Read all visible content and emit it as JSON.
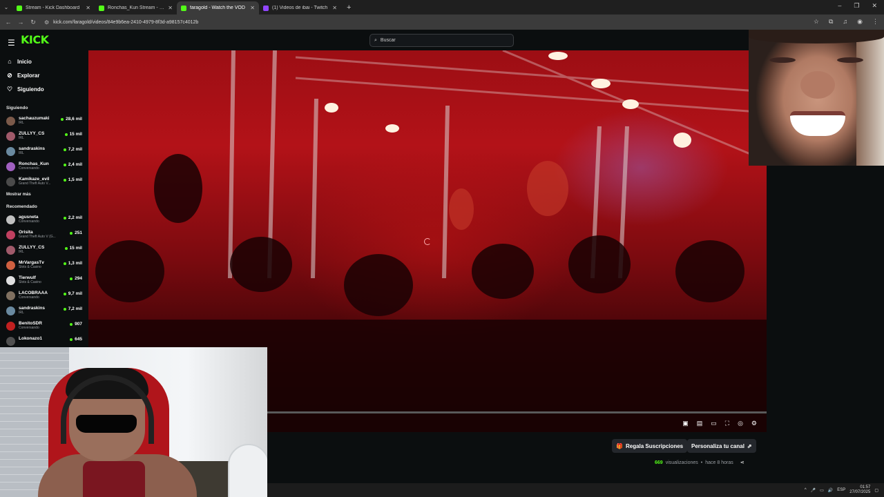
{
  "browser": {
    "tabs": [
      {
        "title": "Stream - Kick Dashboard",
        "color": "#53fc18",
        "active": false
      },
      {
        "title": "Ronchas_Kun Stream - Watch Liv",
        "color": "#53fc18",
        "active": false
      },
      {
        "title": "faragold - Watch the VOD",
        "color": "#53fc18",
        "active": true
      },
      {
        "title": "(1) Videos de ibai - Twitch",
        "color": "#9146ff",
        "active": false
      }
    ],
    "url": "kick.com/faragold/videos/84e9b6ea-2410-4979-8f3d-a98157c4012b"
  },
  "header": {
    "logo": "KICK",
    "search_placeholder": "Buscar"
  },
  "sidebar": {
    "nav": [
      {
        "label": "Inicio",
        "icon": "home-icon"
      },
      {
        "label": "Explorar",
        "icon": "compass-icon"
      },
      {
        "label": "Siguiendo",
        "icon": "heart-icon"
      }
    ],
    "following_title": "Siguiendo",
    "following": [
      {
        "name": "sachauzumaki",
        "category": "IRL",
        "viewers": "28,6 mil",
        "color": "#7b5a4a"
      },
      {
        "name": "ZULLYY_CS",
        "category": "IRL",
        "viewers": "15 mil",
        "color": "#a05a6a"
      },
      {
        "name": "sandraskins",
        "category": "IRL",
        "viewers": "7,2 mil",
        "color": "#6a8aa0"
      },
      {
        "name": "Ronchas_Kun",
        "category": "Conversando",
        "viewers": "2,4 mil",
        "color": "#a060c0"
      },
      {
        "name": "Kamikaze_evil",
        "category": "Grand Theft Auto V...",
        "viewers": "1,5 mil",
        "color": "#4a4a4a"
      }
    ],
    "show_more": "Mostrar más",
    "recommended_title": "Recomendado",
    "recommended": [
      {
        "name": "agusneta",
        "category": "Conversando",
        "viewers": "2,2 mil",
        "color": "#c0c0c0"
      },
      {
        "name": "Orisita",
        "category": "Grand Theft Auto V (G...",
        "viewers": "251",
        "color": "#c04060"
      },
      {
        "name": "ZULLYY_CS",
        "category": "IRL",
        "viewers": "15 mil",
        "color": "#a05a6a"
      },
      {
        "name": "MrVargasTv",
        "category": "Slots & Casino",
        "viewers": "1,3 mil",
        "color": "#d06040"
      },
      {
        "name": "Tierwulf",
        "category": "Slots & Casino",
        "viewers": "294",
        "color": "#e0e0e0"
      },
      {
        "name": "LACOBRAAA",
        "category": "Conversando",
        "viewers": "9,7 mil",
        "color": "#807060"
      },
      {
        "name": "sandraskins",
        "category": "IRL",
        "viewers": "7,2 mil",
        "color": "#6a8aa0"
      },
      {
        "name": "BenitoSDR",
        "category": "Conversando",
        "viewers": "907",
        "color": "#c02020"
      },
      {
        "name": "Lokonazo1",
        "category": "",
        "viewers": "645",
        "color": "#505050"
      }
    ]
  },
  "video": {
    "progress_fraction": 0.0
  },
  "actions": {
    "gift_label": "Regala Suscripciones",
    "customize_label": "Personaliza tu canal"
  },
  "meta": {
    "views_count": "669",
    "views_label": "visualizaciones",
    "time_ago": "hace 8 horas"
  },
  "taskbar": {
    "lang": "ESP",
    "time": "01:57",
    "date": "27/07/2025"
  }
}
